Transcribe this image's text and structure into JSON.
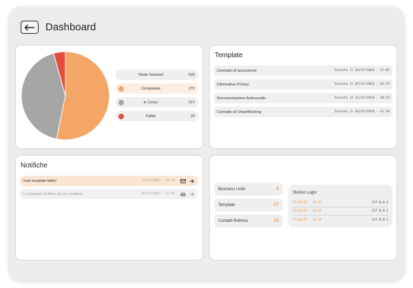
{
  "header": {
    "title": "Dashboard",
    "back_icon": "arrow-left-icon"
  },
  "colors": {
    "accent": "#F4A666",
    "gray": "#A6A6A6",
    "red": "#E74C3C",
    "frame": "#ECECEC"
  },
  "sessions": {
    "legend": [
      {
        "label": "Totale Sessioni",
        "value": "526",
        "color": null
      },
      {
        "label": "Completate",
        "value": "272",
        "color": "#F4A666"
      },
      {
        "label": "In Corso",
        "value": "217",
        "color": "#A6A6A6"
      },
      {
        "label": "Fallite",
        "value": "22",
        "color": "#E74C3C"
      }
    ]
  },
  "chart_data": {
    "type": "pie",
    "labels": [
      "Completate",
      "In Corso",
      "Fallite"
    ],
    "values": [
      272,
      217,
      22
    ],
    "colors": [
      "#F4A666",
      "#A6A6A6",
      "#E74C3C"
    ]
  },
  "templates": {
    "title": "Template",
    "items": [
      {
        "name": "Contratto di assunzione",
        "sent": "Inviato il 03/12/2024 - 13:02"
      },
      {
        "name": "Informativa Privacy",
        "sent": "Inviato il 07/11/2024 - 16:27"
      },
      {
        "name": "Documentazione Antincendio",
        "sent": "Inviato il 11/11/2024 - 10:24"
      },
      {
        "name": "Contratto di SmartWorking",
        "sent": "Inviato il 03/12/2024 - 11:56"
      }
    ]
  },
  "notifications": {
    "title": "Notifiche",
    "items": [
      {
        "text": "Invio template fallito!",
        "date": "17/12/2024 - 16:25",
        "icon": "envelope-icon",
        "active": true
      },
      {
        "text": "La sessione di firma sta per scadere!",
        "date": "03/12/2024 - 11:05",
        "icon": "envelope-open-icon",
        "active": false
      }
    ]
  },
  "stats": [
    {
      "label": "Business Units",
      "value": "3"
    },
    {
      "label": "Template",
      "value": "47"
    },
    {
      "label": "Contatti Rubrica",
      "value": "16"
    }
  ],
  "login_history": {
    "title": "Storico Login",
    "rows": [
      {
        "date": "17/01/25 - 14:57",
        "ip": "127.0.0.1"
      },
      {
        "date": "17/01/25 - 14:52",
        "ip": "127.0.0.1"
      },
      {
        "date": "17/01/25 - 14:49",
        "ip": "127.0.0.1"
      }
    ]
  }
}
